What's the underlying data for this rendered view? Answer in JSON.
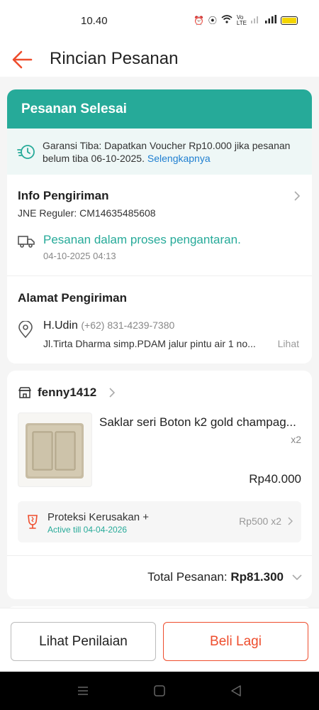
{
  "status_bar": {
    "time": "10.40"
  },
  "header": {
    "title": "Rincian Pesanan"
  },
  "order": {
    "status": "Pesanan Selesai",
    "guarantee_text": "Garansi Tiba: Dapatkan Voucher Rp10.000 jika pesanan belum tiba 06-10-2025.",
    "guarantee_link": "Selengkapnya"
  },
  "shipping": {
    "title": "Info Pengiriman",
    "courier": "JNE Reguler: CM14635485608",
    "status": "Pesanan dalam proses pengantaran.",
    "timestamp": "04-10-2025 04:13"
  },
  "address": {
    "title": "Alamat Pengiriman",
    "name": "H.Udin",
    "phone": "(+62) 831-4239-7380",
    "line": "Jl.Tirta Dharma simp.PDAM jalur pintu air 1 no...",
    "more": "Lihat"
  },
  "shop": {
    "name": "fenny1412",
    "product": {
      "name": "Saklar seri Boton k2 gold champag...",
      "qty": "x2",
      "price": "Rp40.000"
    },
    "protection": {
      "title": "Proteksi Kerusakan +",
      "subtitle": "Active till 04-04-2026",
      "price": "Rp500 x2"
    },
    "total_label": "Total Pesanan:",
    "total_amount": "Rp81.300"
  },
  "actions": {
    "review": "Lihat Penilaian",
    "buy_again": "Beli Lagi"
  },
  "colors": {
    "brand": "#ee4d2d",
    "teal": "#26aa99",
    "link": "#1f7fd1"
  }
}
